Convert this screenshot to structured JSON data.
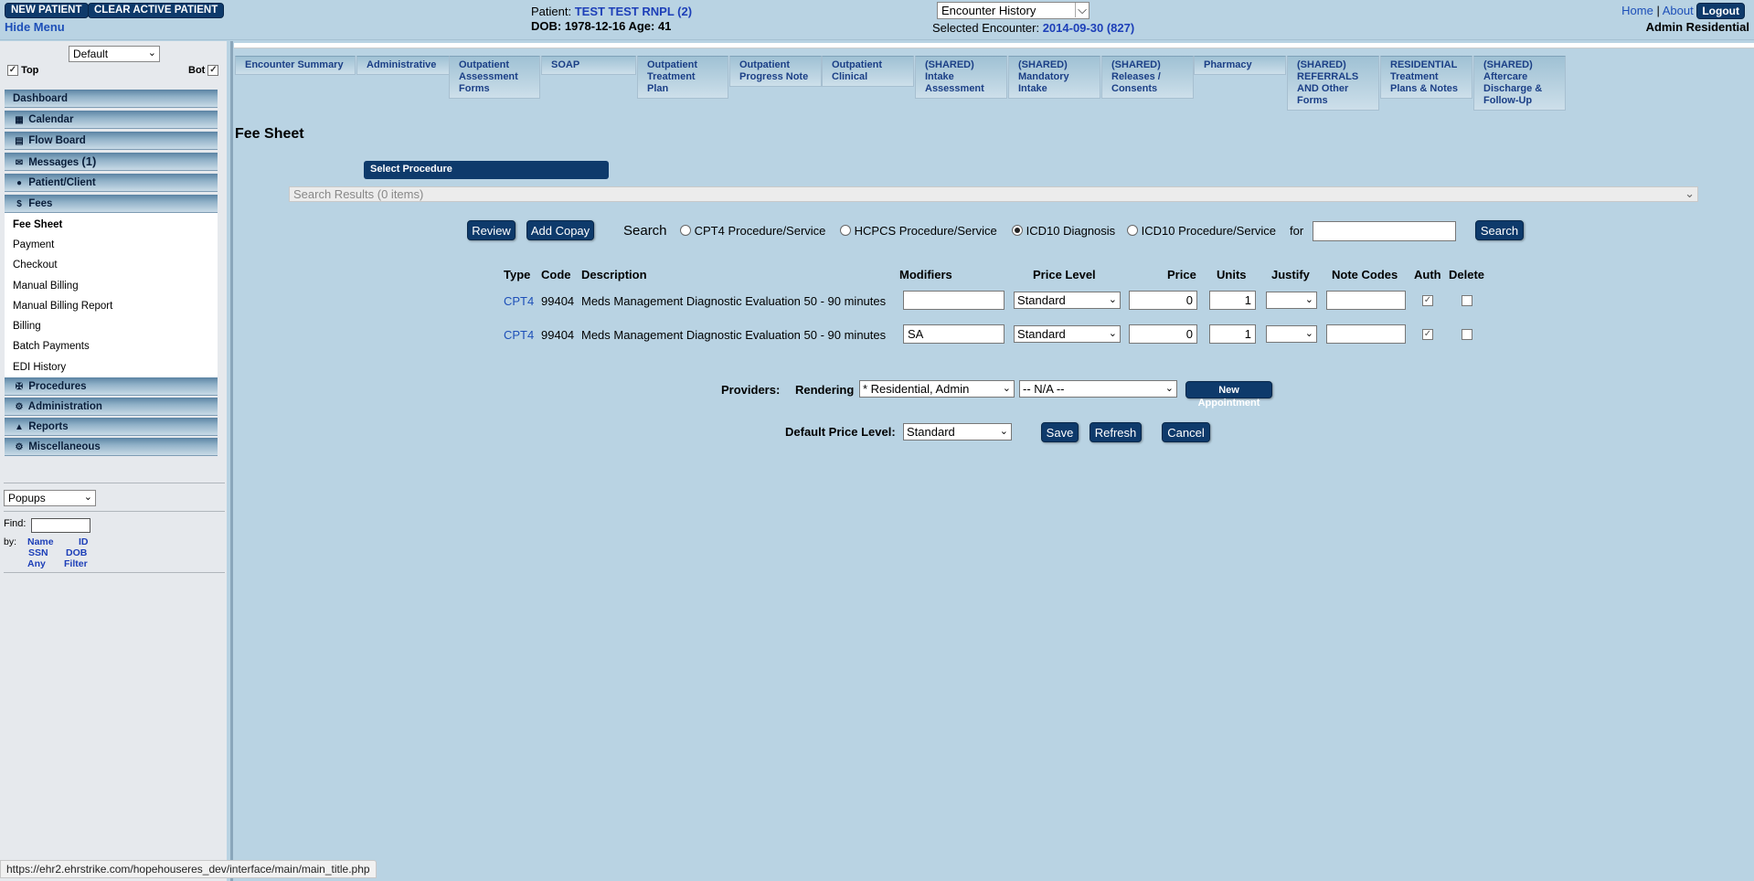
{
  "header": {
    "new_patient": "NEW PATIENT",
    "clear_active": "CLEAR ACTIVE PATIENT",
    "hide_menu": "Hide Menu",
    "patient_label": "Patient:",
    "patient_name": "TEST TEST RNPL (2)",
    "dob_line": "DOB: 1978-12-16 Age: 41",
    "encounter_select": "Encounter History",
    "selected_encounter_label": "Selected Encounter:",
    "selected_encounter": "2014-09-30 (827)",
    "home": "Home",
    "sep": "|",
    "about": "About",
    "logout": "Logout",
    "user": "Admin Residential"
  },
  "sidebar": {
    "view_select": "Default",
    "top_label": "Top",
    "bot_label": "Bot",
    "sections": {
      "dashboard": "Dashboard",
      "calendar": "Calendar",
      "flowboard": "Flow Board",
      "messages": "Messages",
      "messages_count": "(1)",
      "patient": "Patient/Client",
      "fees": "Fees",
      "procedures": "Procedures",
      "administration": "Administration",
      "reports": "Reports",
      "misc": "Miscellaneous"
    },
    "fees_items": [
      "Fee Sheet",
      "Payment",
      "Checkout",
      "Manual Billing",
      "Manual Billing Report",
      "Billing",
      "Batch Payments",
      "EDI History"
    ],
    "popups_select": "Popups",
    "find_label": "Find:",
    "by_label": "by:",
    "find_links": {
      "name": "Name",
      "id": "ID",
      "ssn": "SSN",
      "dob": "DOB",
      "any": "Any",
      "filter": "Filter"
    }
  },
  "tabs": [
    [
      "Encounter Summary"
    ],
    [
      "Administrative"
    ],
    [
      "Outpatient",
      "Assessment",
      "Forms"
    ],
    [
      "SOAP"
    ],
    [
      "Outpatient",
      "Treatment",
      "Plan"
    ],
    [
      "Outpatient",
      "Progress Note"
    ],
    [
      "Outpatient",
      "Clinical"
    ],
    [
      "(SHARED)",
      "Intake",
      "Assessment"
    ],
    [
      "(SHARED)",
      "Mandatory",
      "Intake"
    ],
    [
      "(SHARED)",
      "Releases /",
      "Consents"
    ],
    [
      "Pharmacy"
    ],
    [
      "(SHARED)",
      "REFERRALS",
      "AND Other",
      "Forms"
    ],
    [
      "RESIDENTIAL",
      "Treatment",
      "Plans & Notes"
    ],
    [
      "(SHARED)",
      "Aftercare",
      "Discharge &",
      "Follow-Up"
    ]
  ],
  "fee_sheet": {
    "title": "Fee Sheet",
    "select_procedure": "Select Procedure",
    "search_results": "Search Results (0 items)",
    "review": "Review",
    "add_copay": "Add Copay",
    "search_label": "Search",
    "radio_cpt4": "CPT4 Procedure/Service",
    "radio_hcpcs": "HCPCS Procedure/Service",
    "radio_icd10": "ICD10 Diagnosis",
    "radio_icd10p": "ICD10 Procedure/Service",
    "for_label": "for",
    "search_value": "",
    "search_button": "Search",
    "columns": {
      "type": "Type",
      "code": "Code",
      "description": "Description",
      "modifiers": "Modifiers",
      "price_level": "Price Level",
      "price": "Price",
      "units": "Units",
      "justify": "Justify",
      "note_codes": "Note Codes",
      "auth": "Auth",
      "delete": "Delete"
    },
    "rows": [
      {
        "type": "CPT4",
        "code": "99404",
        "description": "Meds Management Diagnostic Evaluation 50 - 90 minutes",
        "modifiers": "",
        "price_level": "Standard",
        "price": "0",
        "units": "1",
        "justify": "",
        "note_codes": "",
        "auth": true,
        "delete": false
      },
      {
        "type": "CPT4",
        "code": "99404",
        "description": "Meds Management Diagnostic Evaluation 50 - 90 minutes",
        "modifiers": "SA",
        "price_level": "Standard",
        "price": "0",
        "units": "1",
        "justify": "",
        "note_codes": "",
        "auth": true,
        "delete": false
      }
    ],
    "providers_label": "Providers:",
    "rendering_label": "Rendering",
    "rendering_value": "* Residential, Admin",
    "supervisor_value": "-- N/A --",
    "new_appointment": "New Appointment",
    "default_price_label": "Default Price Level:",
    "default_price_value": "Standard",
    "save": "Save",
    "refresh": "Refresh",
    "cancel": "Cancel"
  },
  "status_url": "https://ehr2.ehrstrike.com/hopehouseres_dev/interface/main/main_title.php"
}
